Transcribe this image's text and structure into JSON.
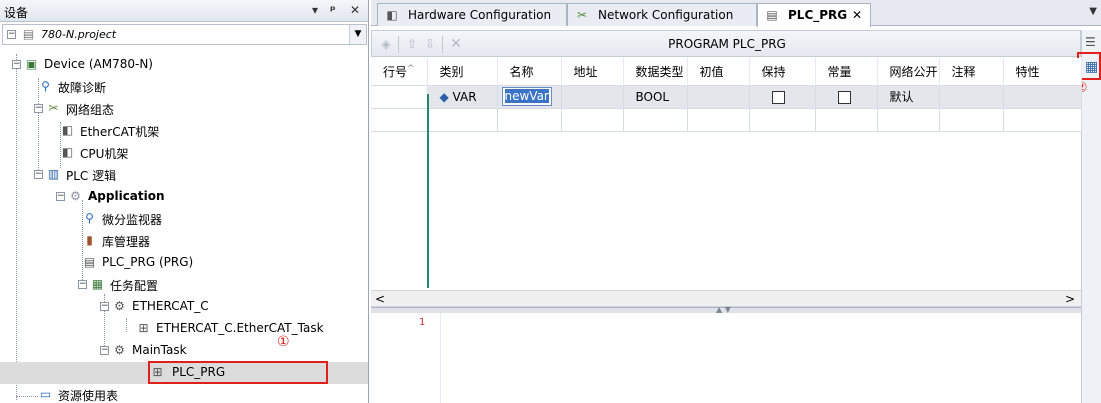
{
  "devices_panel": {
    "title": "设备",
    "controls": [
      "▾",
      "ᵖ",
      "✕"
    ],
    "project": "780-N.project",
    "tree": [
      {
        "label": "Device (AM780-N)",
        "icon": "device-icon",
        "bold": false
      },
      {
        "label": "故障诊断",
        "icon": "magnifier-icon",
        "bold": false
      },
      {
        "label": "网络组态",
        "icon": "network-icon",
        "bold": false
      },
      {
        "label": "EtherCAT机架",
        "icon": "rack-icon",
        "bold": false
      },
      {
        "label": "CPU机架",
        "icon": "rack-icon",
        "bold": false
      },
      {
        "label": "PLC 逻辑",
        "icon": "plc-logic-icon",
        "bold": false
      },
      {
        "label": "Application",
        "icon": "application-gear-icon",
        "bold": true
      },
      {
        "label": "微分监视器",
        "icon": "monitor-icon",
        "bold": false
      },
      {
        "label": "库管理器",
        "icon": "library-icon",
        "bold": false
      },
      {
        "label": "PLC_PRG (PRG)",
        "icon": "pou-icon",
        "bold": false
      },
      {
        "label": "任务配置",
        "icon": "task-config-icon",
        "bold": false
      },
      {
        "label": "ETHERCAT_C",
        "icon": "task-icon",
        "bold": false
      },
      {
        "label": "ETHERCAT_C.EtherCAT_Task",
        "icon": "task-call-icon",
        "bold": false
      },
      {
        "label": "MainTask",
        "icon": "task-icon",
        "bold": false
      },
      {
        "label": "PLC_PRG",
        "icon": "task-call-icon",
        "bold": false
      },
      {
        "label": "资源使用表",
        "icon": "table-icon",
        "bold": false
      }
    ],
    "callout_1": "①"
  },
  "tabs": [
    {
      "label": "Hardware Configuration",
      "icon": "hardware-icon",
      "active": false
    },
    {
      "label": "Network Configuration",
      "icon": "network-icon",
      "active": false
    },
    {
      "label": "PLC_PRG",
      "icon": "pou-icon",
      "active": true
    }
  ],
  "tab_close": "✕",
  "editor": {
    "program_title": "PROGRAM PLC_PRG",
    "columns": [
      "行号",
      "类别",
      "名称",
      "地址",
      "数据类型",
      "初值",
      "保持",
      "常量",
      "网络公开",
      "注释",
      "特性"
    ],
    "rows": [
      {
        "line": "",
        "category": "VAR",
        "name": "newVar",
        "address": "",
        "type": "BOOL",
        "init": "",
        "retain": false,
        "constant": false,
        "network": "默认",
        "comment": "",
        "attr": ""
      }
    ],
    "impl_line": "1",
    "callout_2": "②"
  }
}
